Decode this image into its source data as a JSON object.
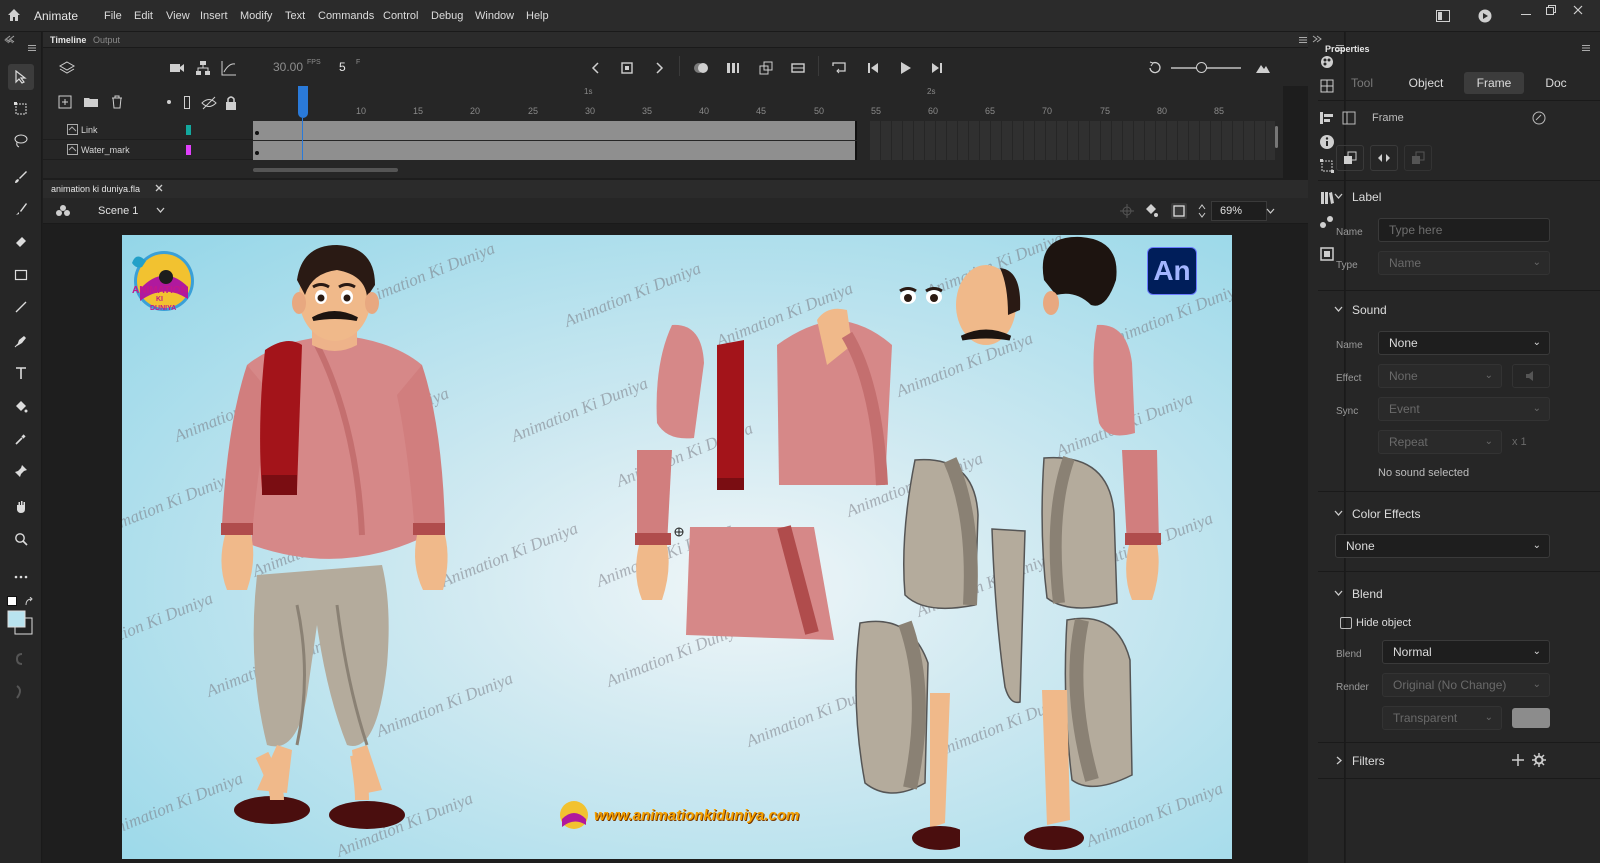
{
  "app": {
    "name": "Animate"
  },
  "menu": [
    "File",
    "Edit",
    "View",
    "Insert",
    "Modify",
    "Text",
    "Commands",
    "Control",
    "Debug",
    "Window",
    "Help"
  ],
  "timeline": {
    "tabs": [
      "Timeline",
      "Output"
    ],
    "fps": "30.00",
    "fps_unit": "FPS",
    "frame": "5",
    "frame_unit": "F",
    "ruler_ticks": [
      "10",
      "15",
      "20",
      "25",
      "30",
      "35",
      "40",
      "45",
      "50",
      "55",
      "60",
      "65",
      "70",
      "75",
      "80",
      "85"
    ],
    "second_marks": [
      "1s",
      "2s"
    ],
    "layers": [
      {
        "name": "Link",
        "color": "#13a89e"
      },
      {
        "name": "Water_mark",
        "color": "#e040fb"
      }
    ]
  },
  "document": {
    "tab": "animation ki duniya.fla",
    "scene": "Scene 1",
    "zoom": "69%"
  },
  "stage": {
    "watermark": "Animation Ki Duniya",
    "logo_text": [
      "ANIMATION",
      "KI",
      "DUNIYA"
    ],
    "badge": "An",
    "url": "www.animationkiduniya.com",
    "bg_color": "#93d6e8"
  },
  "properties": {
    "title": "Properties",
    "tabs": [
      "Tool",
      "Object",
      "Frame",
      "Doc"
    ],
    "active_tab": "Frame",
    "frame_header": "Frame",
    "label": {
      "title": "Label",
      "name_label": "Name",
      "name_placeholder": "Type here",
      "type_label": "Type",
      "type_value": "Name"
    },
    "sound": {
      "title": "Sound",
      "name_label": "Name",
      "name_value": "None",
      "effect_label": "Effect",
      "effect_value": "None",
      "sync_label": "Sync",
      "sync_value": "Event",
      "repeat_value": "Repeat",
      "repeat_count": "x 1",
      "status": "No sound selected"
    },
    "color_effects": {
      "title": "Color Effects",
      "value": "None"
    },
    "blend": {
      "title": "Blend",
      "hide_object": "Hide object",
      "blend_label": "Blend",
      "blend_value": "Normal",
      "render_label": "Render",
      "render_value": "Original (No Change)",
      "transparent_value": "Transparent"
    },
    "filters": {
      "title": "Filters"
    }
  }
}
